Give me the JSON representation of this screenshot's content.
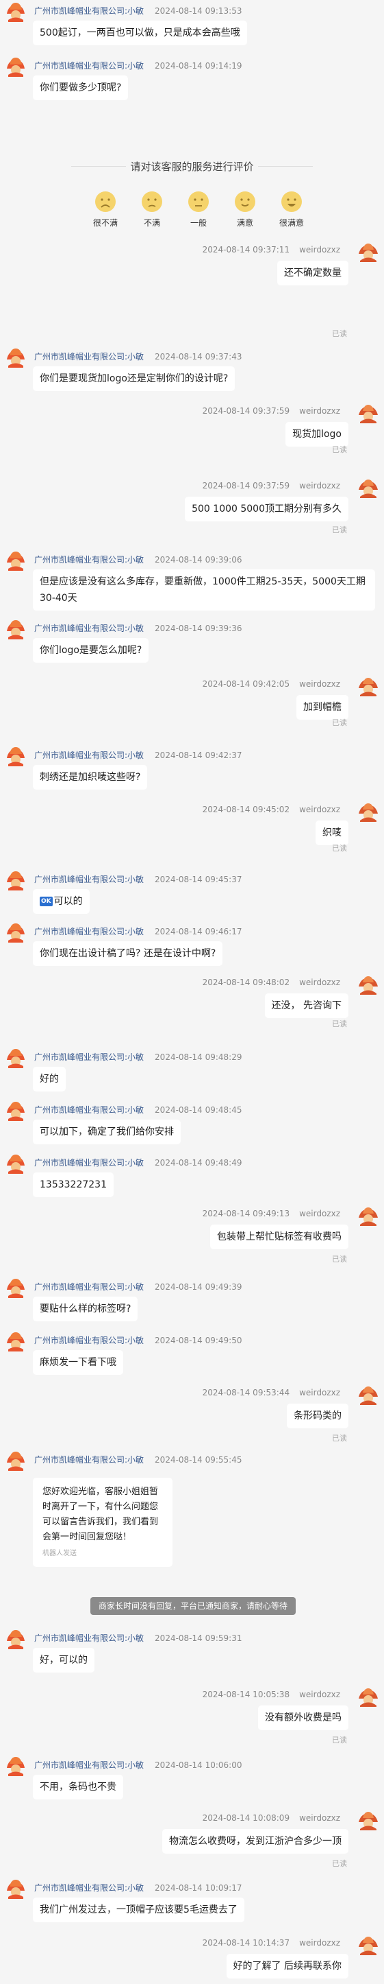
{
  "shop_name": "广州市凯峰帽业有限公司:小敏",
  "user_name": "weirdozxz",
  "read_label": "已读",
  "rating": {
    "title": "请对该客服的服务进行评价",
    "options": [
      "很不满",
      "不满",
      "一般",
      "满意",
      "很满意"
    ]
  },
  "system_notice": "商家长时间没有回复，平台已通知商家，请耐心等待",
  "card_tip": "机器人发送",
  "messages": [
    {
      "time": "2024-08-14 09:13:53",
      "text": "500起订，一两百也可以做，只是成本会高些哦"
    },
    {
      "time": "2024-08-14 09:14:19",
      "text": "你们要做多少顶呢?"
    },
    {
      "time": "2024-08-14 09:37:11",
      "text": "还不确定数量"
    },
    {
      "time": "2024-08-14 09:37:43",
      "text": "你们是要现货加logo还是定制你们的设计呢?"
    },
    {
      "time": "2024-08-14 09:37:59",
      "text": "现货加logo"
    },
    {
      "time": "2024-08-14 09:37:59",
      "text": "500 1000 5000顶工期分别有多久"
    },
    {
      "time": "2024-08-14 09:39:06",
      "text": "但是应该是没有这么多库存，要重新做，1000件工期25-35天，5000天工期30-40天"
    },
    {
      "time": "2024-08-14 09:39:36",
      "text": "你们logo是要怎么加呢?"
    },
    {
      "time": "2024-08-14 09:42:05",
      "text": "加到帽檐"
    },
    {
      "time": "2024-08-14 09:42:37",
      "text": "刺绣还是加织唛这些呀?"
    },
    {
      "time": "2024-08-14 09:45:02",
      "text": "织唛"
    },
    {
      "time": "2024-08-14 09:45:37",
      "text": "可以的",
      "badge": "OK"
    },
    {
      "time": "2024-08-14 09:46:17",
      "text": "你们现在出设计稿了吗? 还是在设计中啊?"
    },
    {
      "time": "2024-08-14 09:48:02",
      "text": "还没，  先咨询下"
    },
    {
      "time": "2024-08-14 09:48:29",
      "text": "好的"
    },
    {
      "time": "2024-08-14 09:48:45",
      "text": "可以加下，确定了我们给你安排"
    },
    {
      "time": "2024-08-14 09:48:49",
      "text": "13533227231"
    },
    {
      "time": "2024-08-14 09:49:13",
      "text": "包装带上帮忙贴标签有收费吗"
    },
    {
      "time": "2024-08-14 09:49:39",
      "text": "要贴什么样的标签呀?"
    },
    {
      "time": "2024-08-14 09:49:50",
      "text": "麻烦发一下看下哦"
    },
    {
      "time": "2024-08-14 09:53:44",
      "text": "条形码类的"
    },
    {
      "time": "2024-08-14 09:55:45",
      "text": "您好欢迎光临，客服小姐姐暂时离开了一下，有什么问题您可以留言告诉我们，我们看到会第一时间回复您哒！"
    },
    {
      "time": "2024-08-14 09:59:31",
      "text": "好，可以的"
    },
    {
      "time": "2024-08-14 10:05:38",
      "text": "没有额外收费是吗"
    },
    {
      "time": "2024-08-14 10:06:00",
      "text": "不用，条码也不贵"
    },
    {
      "time": "2024-08-14 10:08:09",
      "text": "物流怎么收费呀，发到江浙沪合多少一顶"
    },
    {
      "time": "2024-08-14 10:09:17",
      "text": "我们广州发过去，一顶帽子应该要5毛运费去了"
    },
    {
      "time": "2024-08-14 10:14:37",
      "text": "好的了解了 后续再联系你"
    }
  ]
}
